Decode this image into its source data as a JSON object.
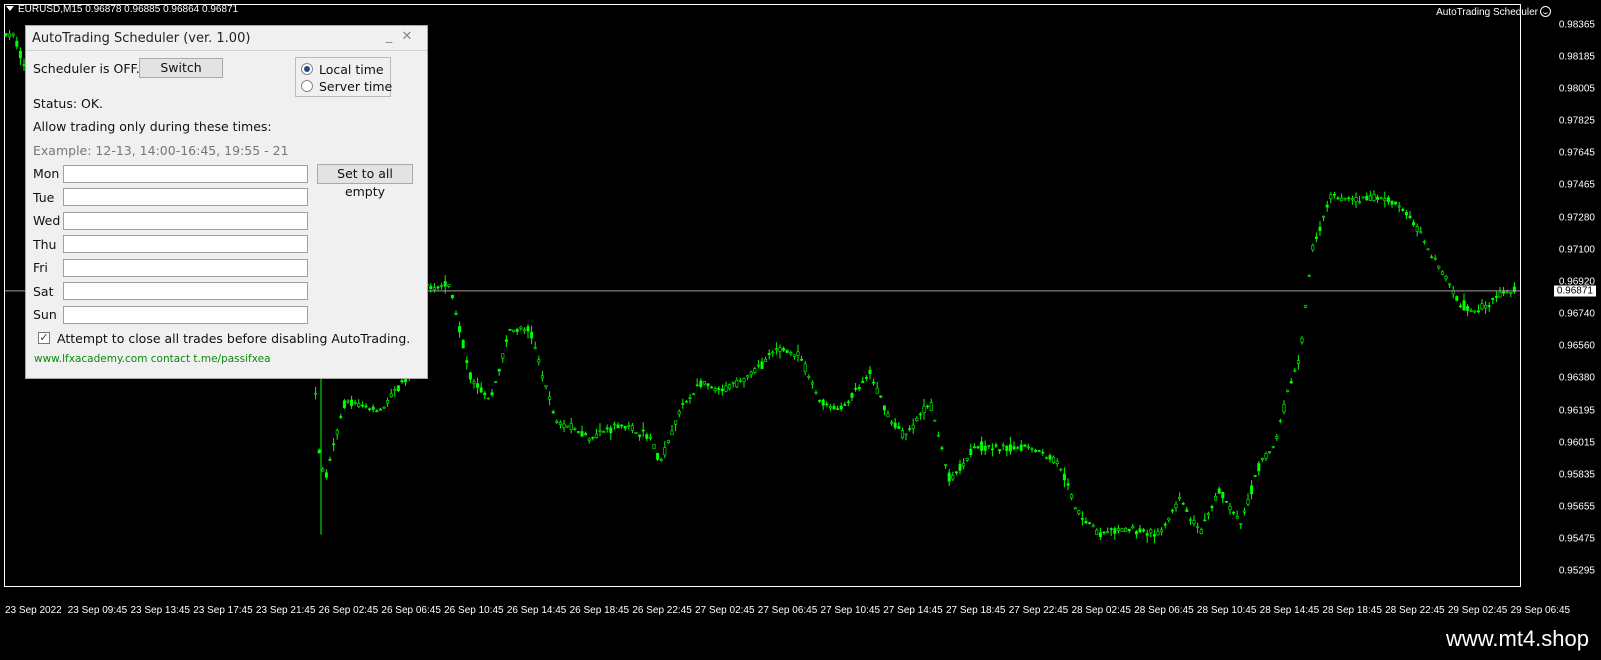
{
  "chart": {
    "symbol_info": "EURUSD,M15  0.96878 0.96885 0.96864 0.96871",
    "ea_name": "AutoTrading Scheduler",
    "current_price": "0.96871",
    "current_value": 0.96871,
    "price_ticks": [
      "0.98365",
      "0.98185",
      "0.98005",
      "0.97825",
      "0.97645",
      "0.97465",
      "0.97280",
      "0.97100",
      "0.96920",
      "0.96740",
      "0.96560",
      "0.96380",
      "0.96195",
      "0.96015",
      "0.95835",
      "0.95655",
      "0.95475",
      "0.95295"
    ],
    "price_range": [
      0.9521,
      0.9848
    ],
    "time_ticks": [
      "23 Sep 2022",
      "23 Sep 09:45",
      "23 Sep 13:45",
      "23 Sep 17:45",
      "23 Sep 21:45",
      "26 Sep 02:45",
      "26 Sep 06:45",
      "26 Sep 10:45",
      "26 Sep 14:45",
      "26 Sep 18:45",
      "26 Sep 22:45",
      "27 Sep 02:45",
      "27 Sep 06:45",
      "27 Sep 10:45",
      "27 Sep 14:45",
      "27 Sep 18:45",
      "27 Sep 22:45",
      "28 Sep 02:45",
      "28 Sep 06:45",
      "28 Sep 10:45",
      "28 Sep 14:45",
      "28 Sep 18:45",
      "28 Sep 22:45",
      "29 Sep 02:45",
      "29 Sep 06:45"
    ],
    "candle_color": "#00ff00",
    "background": "#000000"
  },
  "dialog": {
    "title": "AutoTrading Scheduler (ver. 1.00)",
    "scheduler_status": "Scheduler is OFF.",
    "switch_label": "Switch",
    "radio_local": "Local time",
    "radio_server": "Server time",
    "time_mode": "local",
    "status": "Status: OK.",
    "allow_label": "Allow trading only during these times:",
    "example": "Example: 12-13, 14:00-16:45, 19:55 - 21",
    "set_all_label": "Set to all empty",
    "days": [
      {
        "label": "Mon",
        "value": ""
      },
      {
        "label": "Tue",
        "value": ""
      },
      {
        "label": "Wed",
        "value": ""
      },
      {
        "label": "Thu",
        "value": ""
      },
      {
        "label": "Fri",
        "value": ""
      },
      {
        "label": "Sat",
        "value": ""
      },
      {
        "label": "Sun",
        "value": ""
      }
    ],
    "close_trades_label": "Attempt to close all trades before disabling AutoTrading.",
    "close_trades_checked": true,
    "footer_link": "www.lfxacademy.com contact t.me/passifxea"
  },
  "watermark": "www.mt4.shop"
}
